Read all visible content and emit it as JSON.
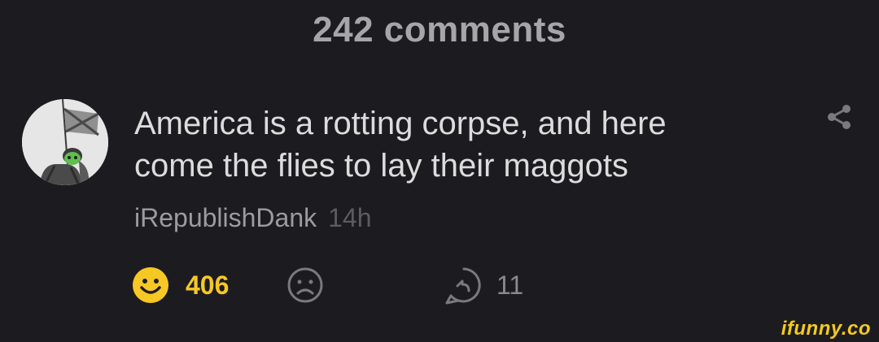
{
  "header": {
    "comments_title": "242 comments"
  },
  "comment": {
    "text_line1": "America is a rotting corpse, and here",
    "text_line2": "come the flies to lay their maggots",
    "username": "iRepublishDank",
    "timestamp": "14h",
    "smile_count": "406",
    "reply_count": "11",
    "icons": {
      "avatar": "user-avatar",
      "share": "share-icon",
      "smile": "smile-icon",
      "unsmile": "unsmile-icon",
      "reply": "reply-icon"
    }
  },
  "watermark": {
    "text": "ifunny.co"
  },
  "colors": {
    "background": "#1c1c20",
    "accent_yellow": "#f7c823",
    "text_primary": "#dcdcdc",
    "text_secondary": "#9c9ca0",
    "text_muted": "#5c5c60"
  }
}
